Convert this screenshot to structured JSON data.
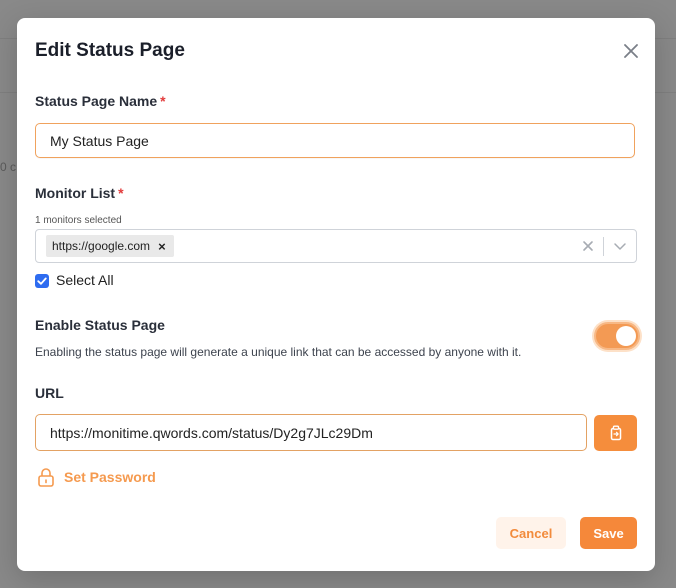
{
  "background": {
    "fragment": "0 c"
  },
  "modal": {
    "title": "Edit Status Page",
    "close_icon": "close-icon"
  },
  "form": {
    "name": {
      "label": "Status Page Name",
      "required_mark": "*",
      "value": "My Status Page"
    },
    "monitors": {
      "label": "Monitor List",
      "required_mark": "*",
      "hint": "1 monitors selected",
      "selected": [
        "https://google.com"
      ],
      "chip_remove": "×"
    },
    "select_all": {
      "label": "Select All",
      "checked": true
    },
    "enable": {
      "label": "Enable Status Page",
      "description": "Enabling the status page will generate a unique link that can be accessed by anyone with it.",
      "enabled": true
    },
    "url": {
      "label": "URL",
      "value": "https://monitime.qwords.com/status/Dy2g7JLc29Dm"
    },
    "set_password": "Set Password"
  },
  "actions": {
    "cancel": "Cancel",
    "save": "Save"
  },
  "colors": {
    "accent": "#f5883a",
    "accent_light": "#fff3ea",
    "required": "#e23b3b",
    "checkbox": "#2e6cf0"
  }
}
